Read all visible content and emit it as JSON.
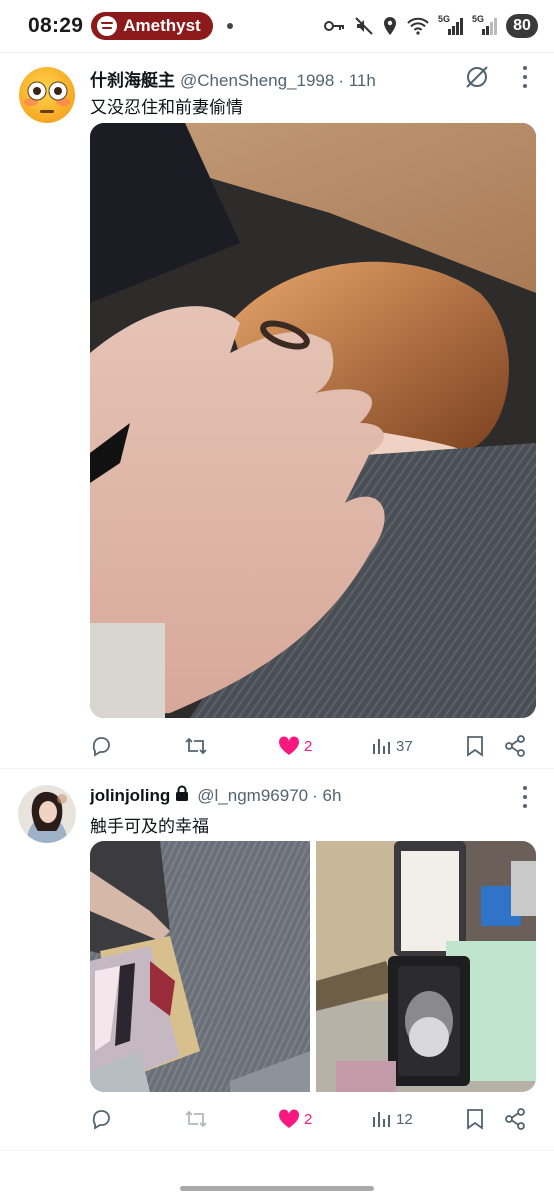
{
  "status_bar": {
    "time": "08:29",
    "spotify_label": "Amethyst",
    "battery": "80",
    "net_label_1": "5G",
    "net_label_2": "5G",
    "icons": [
      "key-icon",
      "mute-icon",
      "location-icon",
      "wifi-icon",
      "signal-icon",
      "signal-icon"
    ]
  },
  "tweets": [
    {
      "display_name": "什刹海艇主",
      "handle": "@ChenSheng_1998",
      "time": "· 11h",
      "text": "又没忍住和前妻偷情",
      "avatar": "emoji-flushed-face",
      "media_count": 1,
      "actions": {
        "reply": "",
        "retweet": "",
        "like": "2",
        "views": "37"
      }
    },
    {
      "display_name": "jolinjoling",
      "handle": "@l_ngm96970",
      "time": "· 6h",
      "text": "触手可及的幸福",
      "avatar": "profile-photo",
      "media_count": 2,
      "actions": {
        "reply": "",
        "retweet": "",
        "like": "2",
        "views": "12"
      }
    }
  ],
  "colors": {
    "spotify_pill": "#8c1a1a",
    "like": "#f91880",
    "muted_text": "#536471",
    "text": "#0f1419"
  }
}
